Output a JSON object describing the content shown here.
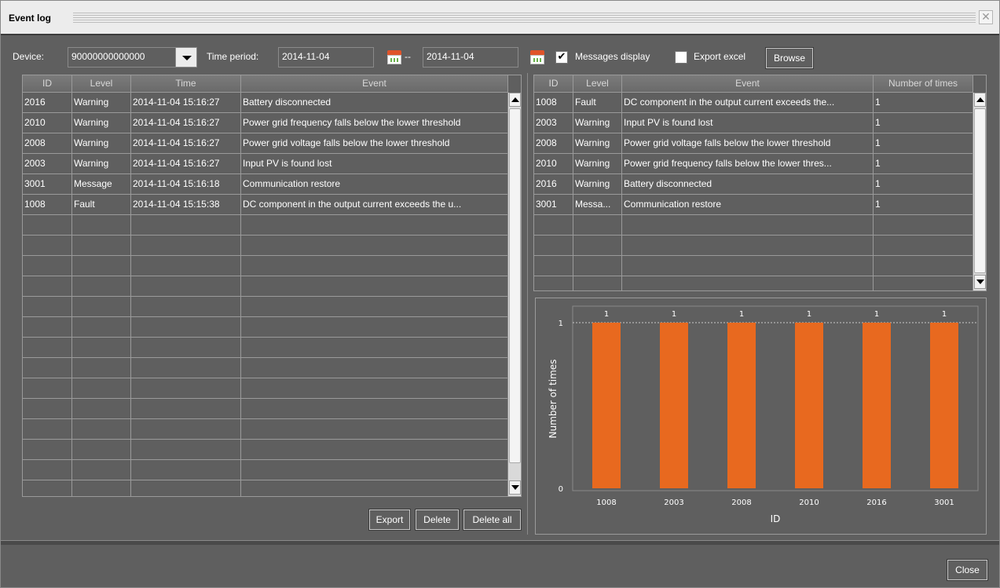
{
  "window": {
    "title": "Event log"
  },
  "toolbar": {
    "device_label": "Device:",
    "device_value": "90000000000000",
    "time_label": "Time period:",
    "start_date": "2014-11-04",
    "date_sep": "--",
    "end_date": "2014-11-04",
    "messages_display_checked": true,
    "messages_display_label": "Messages display",
    "export_excel_checked": false,
    "export_excel_label": "Export excel",
    "browse_label": "Browse"
  },
  "left_table": {
    "columns": [
      "ID",
      "Level",
      "Time",
      "Event"
    ],
    "rows": [
      [
        "2016",
        "Warning",
        "2014-11-04 15:16:27",
        "Battery disconnected"
      ],
      [
        "2010",
        "Warning",
        "2014-11-04 15:16:27",
        "Power grid frequency falls below the lower threshold"
      ],
      [
        "2008",
        "Warning",
        "2014-11-04 15:16:27",
        "Power grid voltage falls below the lower threshold"
      ],
      [
        "2003",
        "Warning",
        "2014-11-04 15:16:27",
        "Input PV is found lost"
      ],
      [
        "3001",
        "Message",
        "2014-11-04 15:16:18",
        "Communication restore"
      ],
      [
        "1008",
        "Fault",
        "2014-11-04 15:15:38",
        "DC component in the output current exceeds the u..."
      ]
    ],
    "empty_rows": 14
  },
  "left_buttons": {
    "export": "Export",
    "delete": "Delete",
    "delete_all": "Delete all"
  },
  "right_table": {
    "columns": [
      "ID",
      "Level",
      "Event",
      "Number of times"
    ],
    "rows": [
      [
        "1008",
        "Fault",
        "DC component in the output current exceeds the...",
        "1"
      ],
      [
        "2003",
        "Warning",
        "Input PV is found lost",
        "1"
      ],
      [
        "2008",
        "Warning",
        "Power grid voltage falls below the lower threshold",
        "1"
      ],
      [
        "2010",
        "Warning",
        "Power grid frequency falls below the lower thres...",
        "1"
      ],
      [
        "2016",
        "Warning",
        "Battery disconnected",
        "1"
      ],
      [
        "3001",
        "Messa...",
        "Communication restore",
        "1"
      ]
    ],
    "empty_rows": 4
  },
  "chart_data": {
    "type": "bar",
    "categories": [
      "1008",
      "2003",
      "2008",
      "2010",
      "2016",
      "3001"
    ],
    "values": [
      1,
      1,
      1,
      1,
      1,
      1
    ],
    "data_labels": [
      "1",
      "1",
      "1",
      "1",
      "1",
      "1"
    ],
    "xlabel": "ID",
    "ylabel": "Number of times",
    "ylim": [
      0,
      1
    ],
    "yticks": [
      "0",
      "1"
    ],
    "bar_color": "#e8691f",
    "grid": false
  },
  "footer": {
    "close_label": "Close"
  },
  "colors": {
    "background": "#5f5f5f",
    "titlebar": "#ececec",
    "bar": "#e8691f"
  }
}
